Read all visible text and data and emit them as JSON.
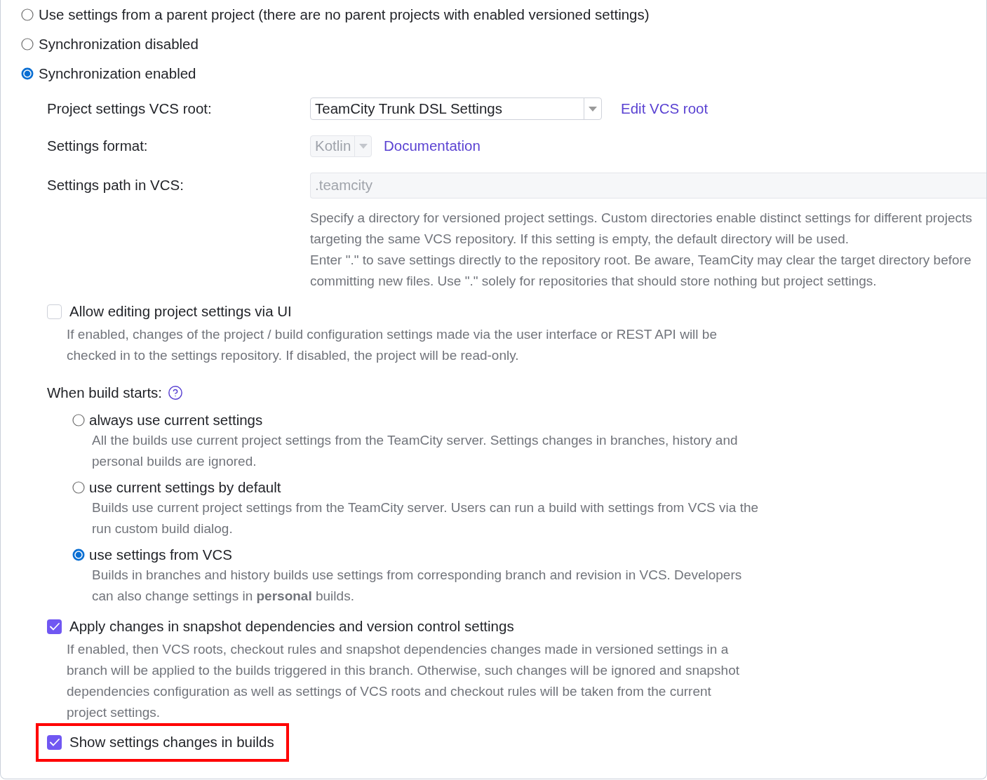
{
  "sync_options": [
    {
      "label": "Use settings from a parent project (there are no parent projects with enabled versioned settings)",
      "selected": false
    },
    {
      "label": "Synchronization disabled",
      "selected": false
    },
    {
      "label": "Synchronization enabled",
      "selected": true
    }
  ],
  "vcs_root": {
    "label": "Project settings VCS root:",
    "value": "TeamCity Trunk DSL Settings",
    "disabled": false,
    "link": "Edit VCS root"
  },
  "settings_format": {
    "label": "Settings format:",
    "value": "Kotlin",
    "disabled": true,
    "link": "Documentation"
  },
  "settings_path": {
    "label": "Settings path in VCS:",
    "value": ".teamcity",
    "disabled": true,
    "help": [
      "Specify a directory for versioned project settings. Custom directories enable distinct settings for different projects targeting the same VCS repository. If this setting is empty, the default directory will be used.",
      "Enter \".\" to save settings directly to the repository root. Be aware, TeamCity may clear the target directory before committing new files. Use \".\" solely for repositories that should store nothing but project settings."
    ]
  },
  "allow_editing": {
    "label": "Allow editing project settings via UI",
    "checked": false,
    "description": "If enabled, changes of the project / build configuration settings made via the user interface or REST API will be checked in to the settings repository. If disabled, the project will be read-only."
  },
  "build_start": {
    "label": "When build starts:",
    "options": [
      {
        "label": "always use current settings",
        "selected": false,
        "description": "All the builds use current project settings from the TeamCity server. Settings changes in branches, history and personal builds are ignored."
      },
      {
        "label": "use current settings by default",
        "selected": false,
        "description": "Builds use current project settings from the TeamCity server. Users can run a build with settings from VCS via the run custom build dialog."
      },
      {
        "label": "use settings from VCS",
        "selected": true,
        "description": "Builds in branches and history builds use settings from corresponding branch and revision in VCS. Developers can also change settings in **personal** builds."
      }
    ]
  },
  "apply_changes": {
    "label": "Apply changes in snapshot dependencies and version control settings",
    "checked": true,
    "description": "If enabled, then VCS roots, checkout rules and snapshot dependencies changes made in versioned settings in a branch will be applied to the builds triggered in this branch. Otherwise, such changes will be ignored and snapshot dependencies configuration as well as settings of VCS roots and checkout rules will be taken from the current project settings."
  },
  "show_changes": {
    "label": "Show settings changes in builds",
    "checked": true,
    "highlighted": true
  }
}
